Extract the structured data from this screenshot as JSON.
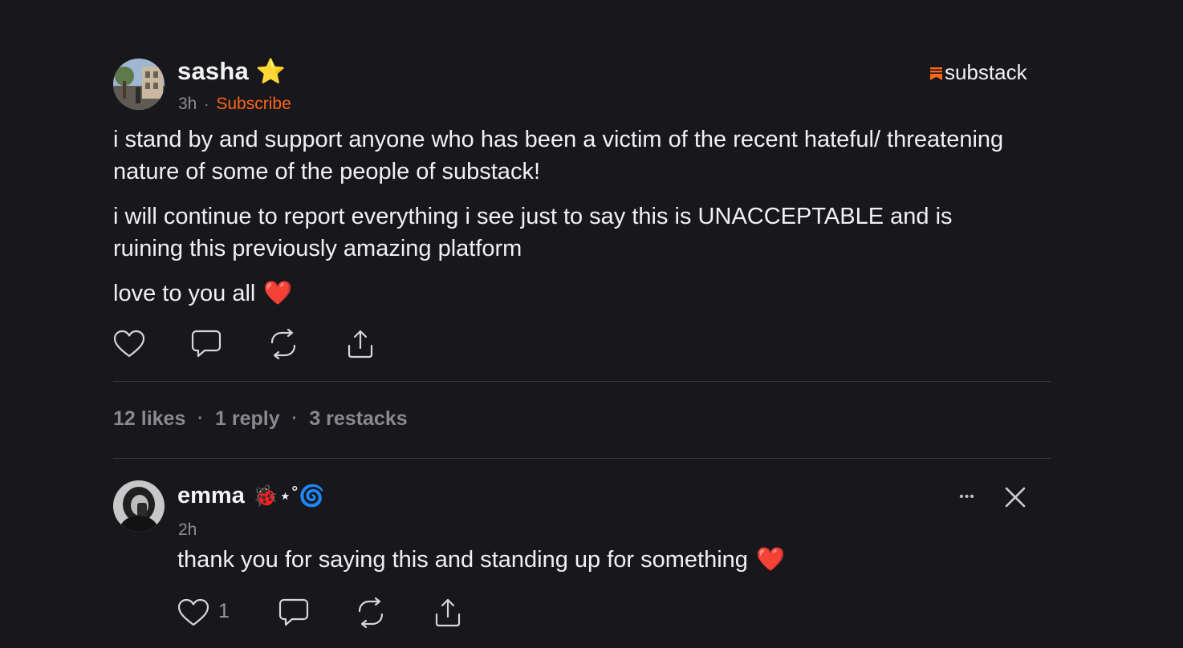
{
  "note": {
    "author": {
      "name": "sasha",
      "badge": "⭐"
    },
    "time": "3h",
    "separator": "·",
    "subscribe_label": "Subscribe",
    "brand": "substack",
    "paragraphs": [
      "i stand by and support anyone who has been a victim of the recent hateful/ threatening nature of some of the people of substack!",
      "i will continue to report everything i see just to say this is UNACCEPTABLE and is ruining this previously amazing platform",
      "love to you all"
    ],
    "heart_emoji": "❤️",
    "actions": [
      "heart-icon",
      "comment-icon",
      "restack-icon",
      "share-icon"
    ],
    "stats": {
      "likes": "12 likes",
      "replies": "1 reply",
      "restacks": "3 restacks",
      "separator": "·"
    }
  },
  "reply": {
    "author": {
      "name": "emma",
      "decoration": "🐞⋆˚🌀"
    },
    "time": "2h",
    "text": "thank you for saying this and standing up for something",
    "heart_emoji": "❤️",
    "like_count": "1",
    "more_label": "•••",
    "close_label": "✕"
  },
  "colors": {
    "background": "#18171c",
    "accent": "#ff6719",
    "muted": "#8e8d93",
    "divider": "#3a393f"
  }
}
